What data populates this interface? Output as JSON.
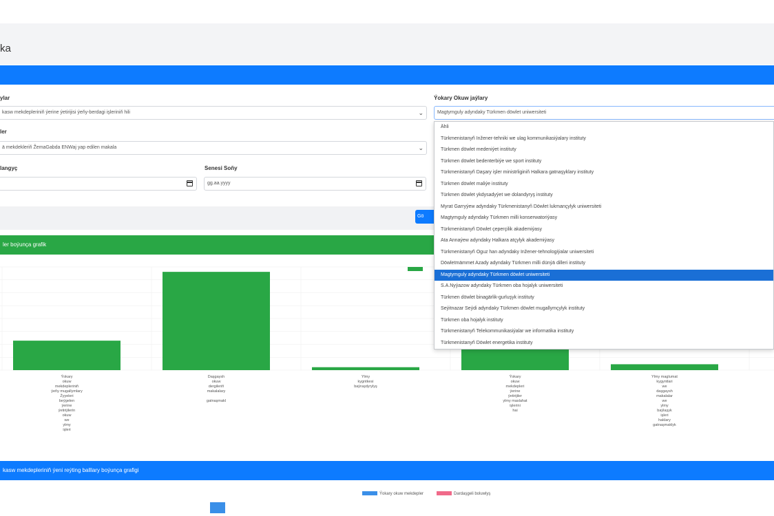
{
  "page": {
    "title": "ka"
  },
  "form": {
    "field1_label": "ylar",
    "field1_value": "kasw mekdepleriniň ýerine ýetirijisi ýeňy-berdagi işleriniň hili",
    "field2_label": "ler",
    "field2_value": "ä mekdekleriň ŽemaGabda ENWaj yap edilen makala",
    "date_start_label": "langyç",
    "date_start_value": "",
    "date_end_label": "Senesi Soňy",
    "date_end_value": "gg.aa.yyyy",
    "university_label": "Ýokary Okuw jaýlary",
    "university_value": "Magtymguly adyndaky Türkmen döwlet uniwersiteti",
    "show_button": "Gö"
  },
  "dropdown": {
    "options": [
      "Ähli",
      "Türkmenistanyň Inžener-tehniki we ulag kommunikasiýalary instituty",
      "Türkmen döwlet medeniýet instituty",
      "Türkmen döwlet bedenterbiýe we sport instituty",
      "Türkmenistanyň Daşary işler ministrliginiň Halkara gatnaşyklary instituty",
      "Türkmen döwlet maliýe instituty",
      "Türkmen döwlet ykdysadyýet we dolandyryş instituty",
      "Myrat Garryýew adyndaky Türkmenistanyň Döwlet lukmançylyk uniwersiteti",
      "Magtymguly adyndaky Türkmen milli konserwatoriýasy",
      "Türkmenistanyň Döwlet çeperçilik akademiýasy",
      "Ata Annaýew adyndaky Halkara atçylyk akademiýasy",
      "Türkmenistanyň Oguz han adyndaky Inžener-tehnologiýalar uniwersiteti",
      "Döwletmämmet Azady adyndaky Türkmen milli dünýä dilleri instituty",
      "Magtymguly adyndaky Türkmen döwlet uniwersiteti",
      "S.A.Nyýazow adyndaky Türkmen oba hojalyk uniwersiteti",
      "Türkmen döwlet binagärlik-gurluşyk instituty",
      "Seýitnazar Seýdi adyndaky Türkmen döwlet mugallymçylyk instituty",
      "Türkmen oba hojalyk instituty",
      "Türkmenistanyň Telekommunikasiýalar we informatika instituty",
      "Türkmenistanyň Döwlet energetika instituty"
    ],
    "selected_index": 13,
    "selected_color": "#1a6fd6"
  },
  "chart1": {
    "header": "ler boýunça grafik",
    "legend_color": "#29a745"
  },
  "chart_data": {
    "type": "bar",
    "categories": [
      "Ýokary\nokuw\nmekdepleriniň\nýeňy mugallymlary\nŽyyeleri\nbeýgelen\nýerine\nýetirijilerin\nokuw\nwe\nylmy\nişleri",
      "Daşgaysh\nokuw\ndergileriň\nmakalalary\n\ngatnaşmakl",
      "Ylmy\nkygntkesi\nbaýraşdyrylyş",
      "Ýokary\nokuw\nmekdepleri\nýerine\nýetirijiler\nylmy maslahat\nişlerini\nhai",
      "Ylmy maglumat\nkygyntlari\nwe\ndaşgaysh\nmakalalar\nwe\nylmy\nbaýlaşyk\nişleri\nhaklary\ngatnaşmaklyk"
    ],
    "values": [
      30,
      100,
      3,
      55,
      6
    ],
    "ylim": [
      0,
      105
    ],
    "color": "#29a745",
    "grid": true
  },
  "chart2": {
    "header": "kasw mekdepleriniň ýeni reýting balllary boýunça grafigi",
    "legend": [
      {
        "label": "Ýokary okuw mekdepler",
        "color": "#3a8fe8"
      },
      {
        "label": "Dardaşgeli boluwlyş",
        "color": "#f06a8a"
      }
    ]
  }
}
